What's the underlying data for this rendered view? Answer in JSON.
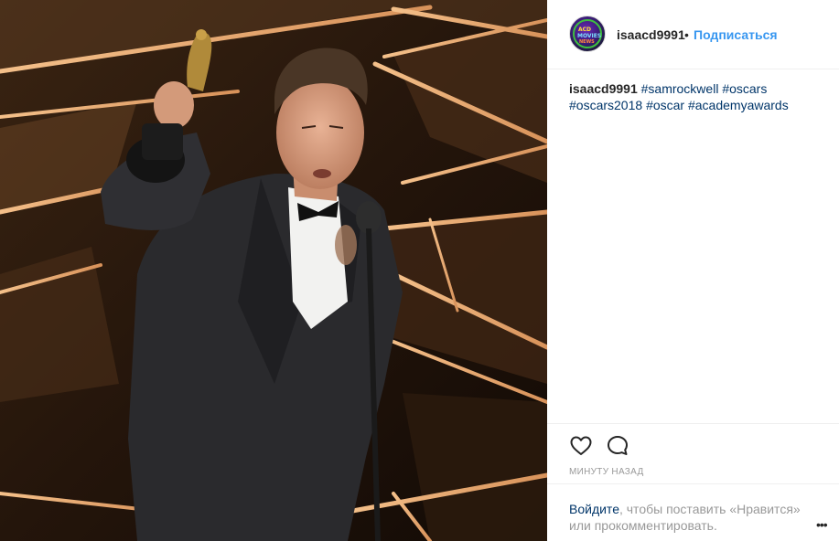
{
  "post": {
    "photo_icon": "photo-of-man-holding-oscar-statuette-at-microphone"
  },
  "header": {
    "username": "isaacd9991",
    "separator": "•",
    "follow_label": "Подписаться",
    "avatar": {
      "line1": "ACD",
      "line2": "MOVIES",
      "line3": "NEWS"
    }
  },
  "caption": {
    "username": "isaacd9991",
    "tags": [
      "#samrockwell",
      "#oscars",
      "#oscars2018",
      "#oscar",
      "#academyawards"
    ]
  },
  "actions": {
    "like_icon": "heart-icon",
    "comment_icon": "comment-bubble-icon"
  },
  "time": "МИНУТУ НАЗАД",
  "footer": {
    "login_link": "Войдите",
    "login_rest": ", чтобы поставить «Нравится» или прокомментировать.",
    "more_icon": "more-dots-icon",
    "more_label": "•••"
  },
  "colors": {
    "link_blue": "#3897f0",
    "tag_blue": "#003569",
    "muted": "#999999",
    "border": "#efefef"
  }
}
